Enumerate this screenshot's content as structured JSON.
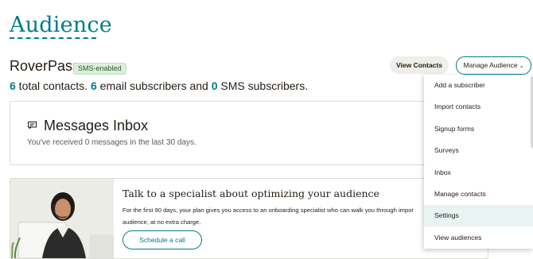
{
  "header": {
    "title": "Audience",
    "list_name": "RoverPass",
    "badge": "SMS-enabled",
    "counts": {
      "total": "6",
      "total_label": " total contacts. ",
      "email": "6",
      "email_label": " email subscribers and ",
      "sms": "0",
      "sms_label": " SMS subscribers."
    },
    "view_contacts_label": "View Contacts",
    "manage_audience_label": "Manage Audience"
  },
  "inbox": {
    "icon": "chat-icon",
    "title": "Messages Inbox",
    "subtitle": "You've received 0 messages in the last 30 days."
  },
  "promo": {
    "title": "Talk to a specialist about optimizing your audience",
    "body": "For the first 90 days, your plan gives you access to an onboarding specialist who can walk you through impor audience, at no extra charge.",
    "button_label": "Schedule a call"
  },
  "dropdown": {
    "items": [
      {
        "label": "Add a subscriber"
      },
      {
        "label": "Import contacts"
      },
      {
        "label": "Signup forms"
      },
      {
        "label": "Surveys"
      },
      {
        "label": "Inbox"
      },
      {
        "label": "Manage contacts"
      },
      {
        "label": "Settings"
      },
      {
        "label": "View audiences"
      }
    ],
    "active_item": "Settings"
  },
  "colors": {
    "accent": "#007c89",
    "text": "#241c15",
    "badge_bg": "#dcefdc",
    "active_item_bg": "#e8f3f2"
  }
}
